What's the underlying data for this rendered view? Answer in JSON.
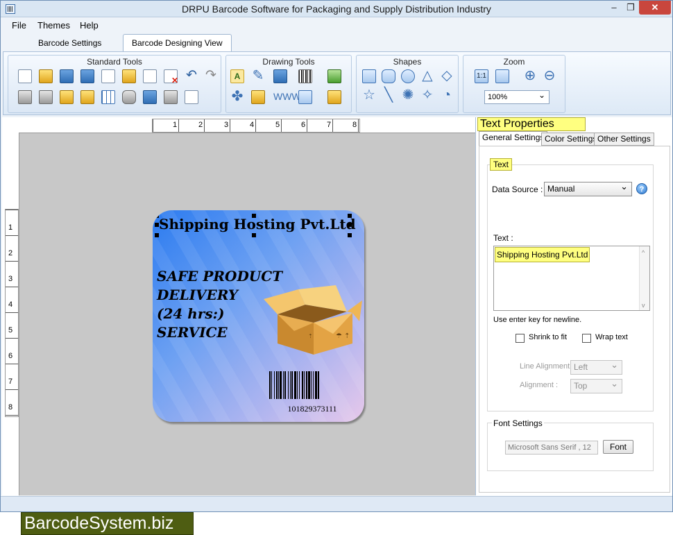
{
  "window": {
    "title": "DRPU Barcode Software for Packaging and Supply Distribution Industry",
    "min": "–",
    "max": "❐",
    "close": "✕"
  },
  "menu": [
    "File",
    "Themes",
    "Help"
  ],
  "main_tabs": [
    "Barcode Settings",
    "Barcode Designing View"
  ],
  "ribbon": {
    "standard_tools": "Standard Tools",
    "drawing_tools": "Drawing Tools",
    "shapes": "Shapes",
    "zoom": "Zoom",
    "zoom_value": "100%"
  },
  "ruler": {
    "h": [
      "1",
      "2",
      "3",
      "4",
      "5",
      "6",
      "7",
      "8"
    ],
    "v": [
      "1",
      "2",
      "3",
      "4",
      "5",
      "6",
      "7",
      "8"
    ]
  },
  "label": {
    "title": "Shipping Hosting Pvt.Ltd",
    "slogan": "SAFE PRODUCT\nDELIVERY\n(24 hrs:)\nSERVICE",
    "barcode_number": "101829373111"
  },
  "props": {
    "title": "Text Properties",
    "tabs": [
      "General Settings",
      "Color Settings",
      "Other Settings"
    ],
    "text_group": "Text",
    "data_source_label": "Data Source :",
    "data_source_value": "Manual",
    "help": "?",
    "text_label": "Text :",
    "text_value": "Shipping Hosting Pvt.Ltd",
    "hint": "Use enter key for newline.",
    "shrink_to_fit": "Shrink to fit",
    "wrap_text": "Wrap text",
    "line_alignment_label": "Line Alignment",
    "line_alignment_value": "Left",
    "alignment_label": "Alignment :",
    "alignment_value": "Top",
    "font_group": "Font Settings",
    "font_value": "Microsoft Sans Serif , 12",
    "font_button": "Font"
  },
  "watermark": "BarcodeSystem.biz"
}
